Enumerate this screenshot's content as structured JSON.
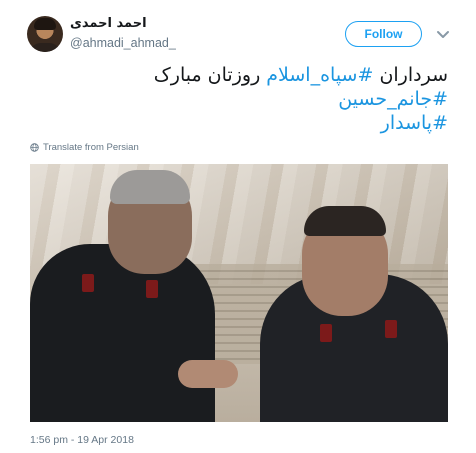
{
  "user": {
    "display_name": "احمد احمدی",
    "handle": "@ahmadi_ahmad_"
  },
  "follow_button": {
    "label": "Follow"
  },
  "tweet": {
    "line1_plain_start": "سرداران ",
    "line1_hashtag": "#سپاه_اسلام",
    "line1_plain_end": " روزتان مبارک",
    "hashtag2": "#جانم_حسین",
    "hashtag3": "#پاسدار"
  },
  "translate": {
    "label": "Translate from Persian",
    "icon": "globe-icon"
  },
  "timestamp": "1:56 pm - 19 Apr 2018",
  "colors": {
    "accent": "#1da1f2",
    "hashtag": "#1b95e0",
    "text": "#14171a",
    "muted": "#657786"
  }
}
